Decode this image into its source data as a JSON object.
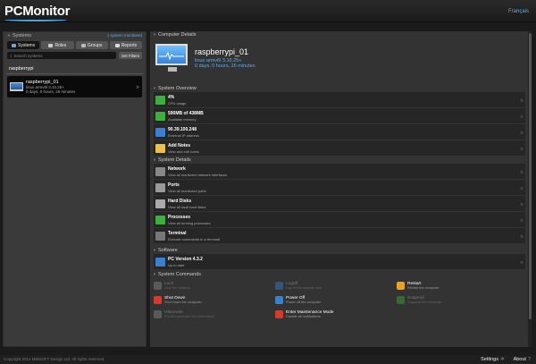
{
  "header": {
    "logo": "PCMonitor",
    "language": "Français"
  },
  "left": {
    "section_title": "Systems",
    "selected_label": "1 system monitored",
    "tabs": [
      {
        "label": "Systems",
        "icon": "monitor-icon",
        "active": true
      },
      {
        "label": "Roles",
        "icon": "pencil-icon",
        "active": false
      },
      {
        "label": "Groups",
        "icon": "group-icon",
        "active": false
      },
      {
        "label": "Reports",
        "icon": "document-icon",
        "active": false
      }
    ],
    "search_placeholder": "Search systems",
    "filter_button": "Set Filters",
    "group_name": "raspberrypi",
    "device": {
      "name": "raspberrypi_01",
      "os": "linux armv6l 3.10.25+",
      "uptime": "0 days, 0 hours, 26 minutes"
    }
  },
  "computer": {
    "section_title": "Computer Details",
    "name": "raspberrypi_01",
    "os": "linux armv6l 3.10.25+",
    "uptime": "0 days, 0 hours, 26 minutes"
  },
  "overview": {
    "section_title": "System Overview",
    "rows": [
      {
        "title": "4%",
        "subtitle": "CPU usage",
        "icon": "cpu-icon",
        "color": "#3fae3f"
      },
      {
        "title": "590MB of 438MB",
        "subtitle": "Available memory",
        "icon": "memory-icon",
        "color": "#3fae3f"
      },
      {
        "title": "90.39.100.248",
        "subtitle": "External IP address",
        "icon": "globe-icon",
        "color": "#3a7fd0"
      },
      {
        "title": "Add Notes",
        "subtitle": "View and edit notes",
        "icon": "notes-icon",
        "color": "#e8c24a"
      }
    ]
  },
  "details": {
    "section_title": "System Details",
    "rows": [
      {
        "title": "Network",
        "subtitle": "View all monitored network interfaces",
        "icon": "network-icon",
        "color": "#888888"
      },
      {
        "title": "Ports",
        "subtitle": "View all monitored ports",
        "icon": "ports-icon",
        "color": "#999999"
      },
      {
        "title": "Hard Disks",
        "subtitle": "View all local hard disks",
        "icon": "disk-icon",
        "color": "#aaaaaa"
      },
      {
        "title": "Processes",
        "subtitle": "View all running processes",
        "icon": "processes-icon",
        "color": "#3fae3f"
      },
      {
        "title": "Terminal",
        "subtitle": "Execute commands in a terminal",
        "icon": "terminal-icon",
        "color": "#777777"
      }
    ]
  },
  "software": {
    "section_title": "Software",
    "row": {
      "title": "PC Version 4.3.2",
      "subtitle": "Up to date",
      "icon": "software-icon",
      "color": "#3a7fd0"
    }
  },
  "commands": {
    "section_title": "System Commands",
    "items": [
      {
        "title": "Lock",
        "subtitle": "Lock the desktop",
        "icon": "lock-icon",
        "color": "#888888",
        "enabled": false
      },
      {
        "title": "Logoff",
        "subtitle": "Log off the console user",
        "icon": "logoff-icon",
        "color": "#3a7fd0",
        "enabled": false
      },
      {
        "title": "Restart",
        "subtitle": "Restart the computer",
        "icon": "restart-icon",
        "color": "#e8a321",
        "enabled": true
      },
      {
        "title": "Shut Down",
        "subtitle": "Shut Down the computer",
        "icon": "shutdown-icon",
        "color": "#d63a2c",
        "enabled": true
      },
      {
        "title": "Power Off",
        "subtitle": "Power off the computer",
        "icon": "power-off-icon",
        "color": "#3a7fd0",
        "enabled": true
      },
      {
        "title": "Suspend",
        "subtitle": "Suspend the computer",
        "icon": "suspend-icon",
        "color": "#3fae3f",
        "enabled": false
      },
      {
        "title": "Hibernate",
        "subtitle": "Put the computer into hibernation",
        "icon": "hibernate-icon",
        "color": "#888888",
        "enabled": false
      },
      {
        "title": "Enter Maintenance Mode",
        "subtitle": "Disable all notifications",
        "icon": "maintenance-icon",
        "color": "#d63a2c",
        "enabled": true
      }
    ]
  },
  "footer": {
    "copyright": "Copyright 2014 MMSOFT Design Ltd. All rights reserved.",
    "settings": "Settings",
    "about": "About"
  }
}
